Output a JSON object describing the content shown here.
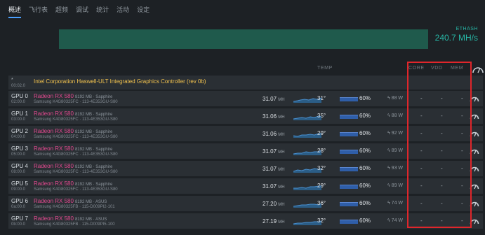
{
  "tabs": [
    "概述",
    "飞行表",
    "超频",
    "调试",
    "统计",
    "活动",
    "设定"
  ],
  "hashrate": {
    "algo": "ETHASH",
    "value": "240.7 MH/s"
  },
  "headers": {
    "temp": "TEMP",
    "core": "CORE",
    "vdd": "VDD",
    "mem": "MEM"
  },
  "cpu": {
    "star": "*",
    "bus": "00:02.0",
    "name": "Intel Corporation Haswell-ULT Integrated Graphics Controller (rev 0b)"
  },
  "gpus": [
    {
      "name": "GPU 0",
      "bus": "02:00.0",
      "model": "Radeon RX 580",
      "mem": "8192 MB · Sapphire",
      "sub": "Samsung K4G80325FC · 113-4E353GU-S80",
      "rate": "31.07",
      "unit": "MH",
      "temp": "31°",
      "fan": "60%",
      "power": "88 W",
      "core": "-",
      "vdd": "-",
      "memc": "-"
    },
    {
      "name": "GPU 1",
      "bus": "03:00.0",
      "model": "Radeon RX 580",
      "mem": "8192 MB · Sapphire",
      "sub": "Samsung K4G80325FC · 113-4E353GU-S80",
      "rate": "31.06",
      "unit": "MH",
      "temp": "35°",
      "fan": "60%",
      "power": "88 W",
      "core": "-",
      "vdd": "-",
      "memc": "-"
    },
    {
      "name": "GPU 2",
      "bus": "04:00.0",
      "model": "Radeon RX 580",
      "mem": "8192 MB · Sapphire",
      "sub": "Samsung K4G80325FC · 113-4E353GU-S80",
      "rate": "31.06",
      "unit": "MH",
      "temp": "29°",
      "fan": "60%",
      "power": "92 W",
      "core": "-",
      "vdd": "-",
      "memc": "-"
    },
    {
      "name": "GPU 3",
      "bus": "05:00.0",
      "model": "Radeon RX 580",
      "mem": "8192 MB · Sapphire",
      "sub": "Samsung K4G80325FC · 113-4E353GU-S80",
      "rate": "31.07",
      "unit": "MH",
      "temp": "28°",
      "fan": "60%",
      "power": "89 W",
      "core": "-",
      "vdd": "-",
      "memc": "-"
    },
    {
      "name": "GPU 4",
      "bus": "08:00.0",
      "model": "Radeon RX 580",
      "mem": "8192 MB · Sapphire",
      "sub": "Samsung K4G80325FC · 113-4E353GU-S80",
      "rate": "31.07",
      "unit": "MH",
      "temp": "32°",
      "fan": "60%",
      "power": "93 W",
      "core": "-",
      "vdd": "-",
      "memc": "-"
    },
    {
      "name": "GPU 5",
      "bus": "09:00.0",
      "model": "Radeon RX 580",
      "mem": "8192 MB · Sapphire",
      "sub": "Samsung K4G80325FC · 113-4E353GU-S80",
      "rate": "31.07",
      "unit": "MH",
      "temp": "29°",
      "fan": "60%",
      "power": "89 W",
      "core": "-",
      "vdd": "-",
      "memc": "-"
    },
    {
      "name": "GPU 6",
      "bus": "0a:00.0",
      "model": "Radeon RX 580",
      "mem": "8192 MB · ASUS",
      "sub": "Samsung K4G80325FB · 115-D009PI2-101",
      "rate": "27.20",
      "unit": "MH",
      "temp": "36°",
      "fan": "60%",
      "power": "74 W",
      "core": "-",
      "vdd": "-",
      "memc": "-"
    },
    {
      "name": "GPU 7",
      "bus": "0b:00.0",
      "model": "Radeon RX 580",
      "mem": "8192 MB · ASUS",
      "sub": "Samsung K4G80325FB · 115-D009PI5-100",
      "rate": "27.19",
      "unit": "MH",
      "temp": "32°",
      "fan": "60%",
      "power": "74 W",
      "core": "-",
      "vdd": "-",
      "memc": "-"
    }
  ],
  "colors": {
    "accent": "#27b7a6",
    "model": "#e2498f",
    "cpu": "#f3c34e",
    "highlight": "#e0262b"
  }
}
